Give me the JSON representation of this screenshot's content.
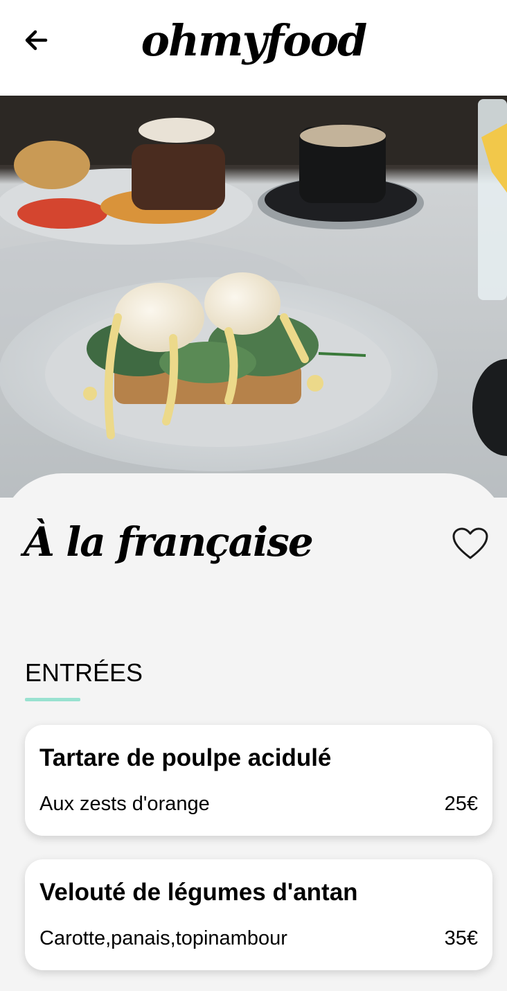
{
  "header": {
    "back_icon": "arrow-left-icon",
    "logo": "ohmyfood"
  },
  "hero": {
    "image": "photo of eggs benedict on spinach and toast with hollandaise sauce on a white plate"
  },
  "restaurant": {
    "name": "À la française",
    "favorite_icon": "heart-outline-icon"
  },
  "menu": {
    "section_title": "ENTRÉES",
    "accent_color": "#99e2d0",
    "dishes": [
      {
        "name": "Tartare de poulpe acidulé",
        "description": "Aux zests d'orange",
        "price": "25€"
      },
      {
        "name": "Velouté de légumes d'antan",
        "description": "Carotte,panais,topinambour",
        "price": "35€"
      }
    ]
  }
}
